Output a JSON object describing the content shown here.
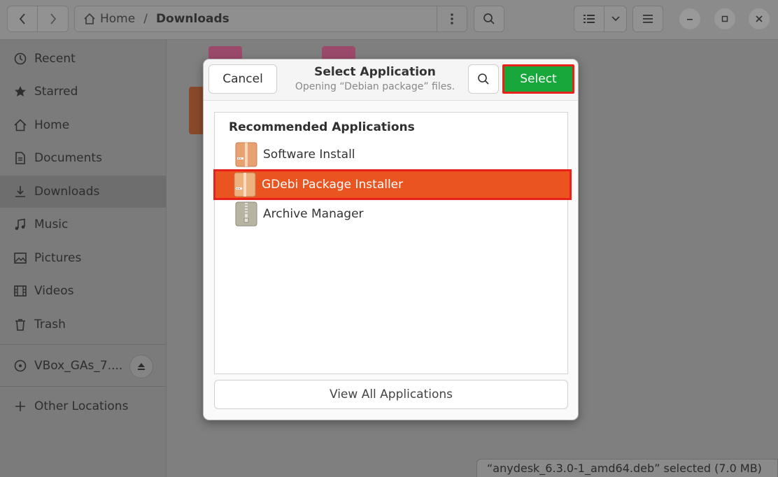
{
  "header": {
    "path": [
      "Home",
      "Downloads"
    ],
    "separator": "/"
  },
  "sidebar": {
    "items": [
      {
        "label": "Recent",
        "icon": "clock-icon"
      },
      {
        "label": "Starred",
        "icon": "star-icon"
      },
      {
        "label": "Home",
        "icon": "home-icon"
      },
      {
        "label": "Documents",
        "icon": "document-icon"
      },
      {
        "label": "Downloads",
        "icon": "download-icon",
        "active": true
      },
      {
        "label": "Music",
        "icon": "music-icon"
      },
      {
        "label": "Pictures",
        "icon": "picture-icon"
      },
      {
        "label": "Videos",
        "icon": "video-icon"
      },
      {
        "label": "Trash",
        "icon": "trash-icon"
      }
    ],
    "device": {
      "label": "VBox_GAs_7....",
      "icon": "disc-icon"
    },
    "other_locations": {
      "label": "Other Locations",
      "icon": "plus-icon"
    }
  },
  "dialog": {
    "cancel_label": "Cancel",
    "title": "Select Application",
    "subtitle": "Opening “Debian package” files.",
    "select_label": "Select",
    "list_heading": "Recommended Applications",
    "apps": [
      {
        "label": "Software Install",
        "icon": "package-icon"
      },
      {
        "label": "GDebi Package Installer",
        "icon": "package-icon",
        "selected": true
      },
      {
        "label": "Archive Manager",
        "icon": "archive-icon"
      }
    ],
    "view_all_label": "View All Applications"
  },
  "status": {
    "text": "“anydesk_6.3.0-1_amd64.deb” selected  (7.0 MB)"
  },
  "colors": {
    "accent": "#e95420",
    "select_button": "#18a73a",
    "highlight_outline": "#e8221b"
  }
}
